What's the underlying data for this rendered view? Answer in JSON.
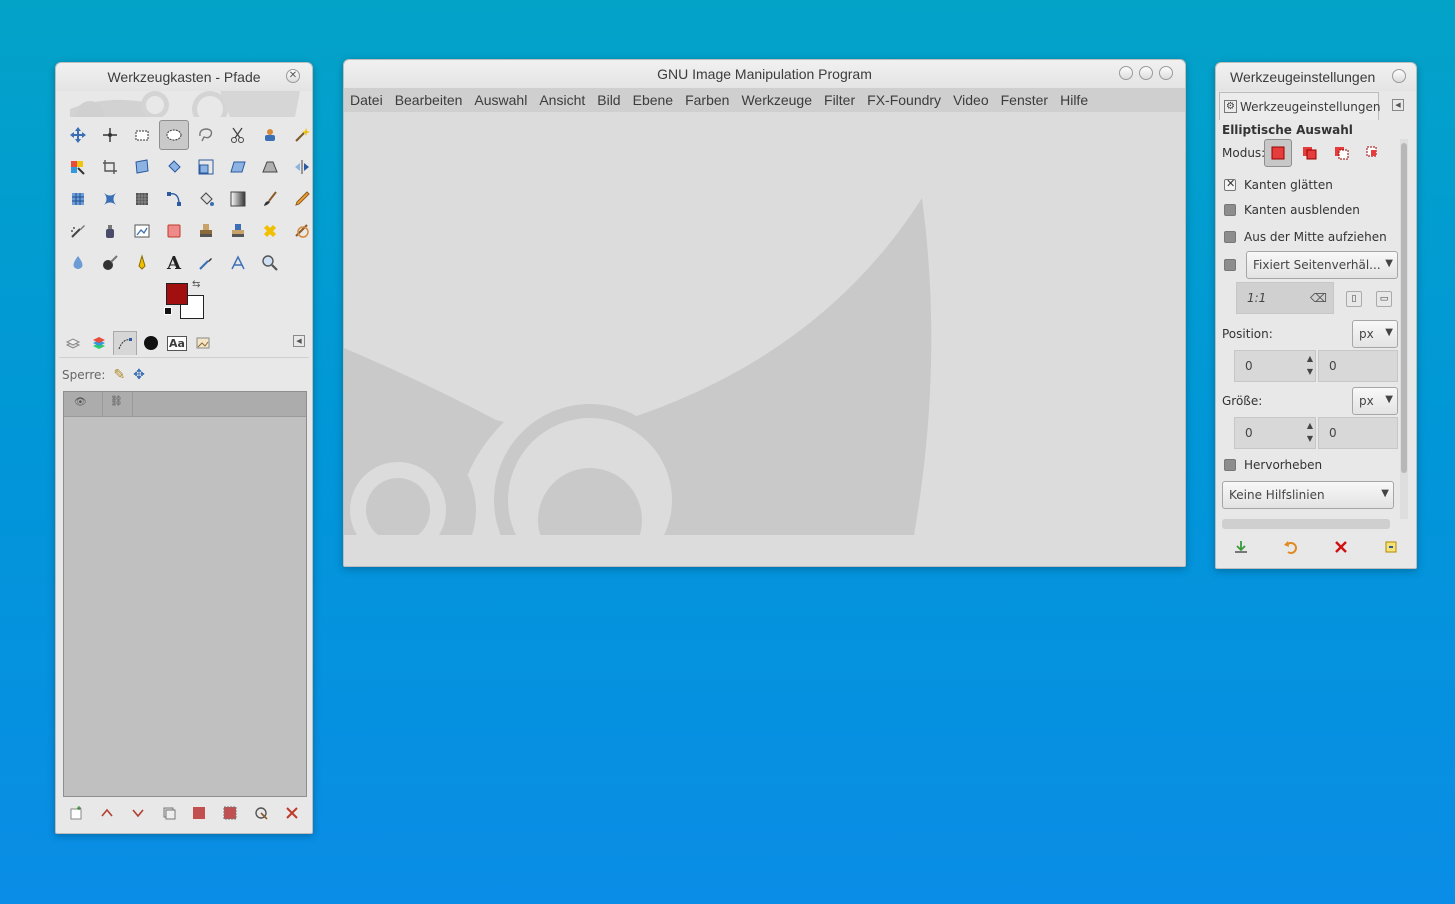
{
  "toolbox": {
    "title": "Werkzeugkasten - Pfade",
    "tools": [
      "move-icon",
      "align-icon",
      "rect-select-icon",
      "ellipse-select-icon",
      "lasso-icon",
      "scissors-select-icon",
      "foreground-select-icon",
      "fuzzy-select-icon",
      "color-select-icon",
      "crop-icon",
      "unified-transform-icon",
      "rotate-icon",
      "scale-icon",
      "shear-icon",
      "perspective-icon",
      "flip-icon",
      "cage-transform-icon",
      "warp-icon",
      "handle-transform-icon",
      "paths-tool-icon",
      "bucket-fill-icon",
      "gradient-icon",
      "paintbrush-icon",
      "pencil-icon",
      "airbrush-icon",
      "ink-icon",
      "mypaint-brush-icon",
      "eraser-icon",
      "clone-icon",
      "heal-icon",
      "smudge-icon",
      "dodge-burn-icon",
      "blur-icon",
      "smudge-alt-icon",
      "dodge-icon",
      "text-icon",
      "color-picker-icon",
      "measure-icon",
      "zoom-icon"
    ],
    "active_tool": "ellipse-select-icon",
    "fg_color": "#a10f0f",
    "bg_color": "#ffffff",
    "text_tool_glyph": "A",
    "dock_tabs": [
      "layers-tab-icon",
      "channels-tab-icon",
      "paths-tab-icon",
      "brushes-tab-icon",
      "fonts-tab-icon",
      "images-tab-icon"
    ],
    "font_tab_label": "Aa",
    "lock_label": "Sperre:",
    "bottom_buttons": [
      "new-path-icon",
      "raise-path-icon",
      "lower-path-icon",
      "duplicate-path-icon",
      "path-to-selection-icon",
      "selection-to-path-icon",
      "paint-along-path-icon",
      "delete-path-icon"
    ]
  },
  "main": {
    "title": "GNU Image Manipulation Program",
    "menu": [
      "Datei",
      "Bearbeiten",
      "Auswahl",
      "Ansicht",
      "Bild",
      "Ebene",
      "Farben",
      "Werkzeuge",
      "Filter",
      "FX-Foundry",
      "Video",
      "Fenster",
      "Hilfe"
    ]
  },
  "options": {
    "title": "Werkzeugeinstellungen",
    "tab_label": "Werkzeugeinstellungen",
    "tool_name": "Elliptische Auswahl",
    "mode_label": "Modus:",
    "antialias_label": "Kanten glätten",
    "antialias_checked": true,
    "feather_label": "Kanten ausblenden",
    "feather_checked": false,
    "expand_center_label": "Aus der Mitte aufziehen",
    "expand_center_checked": false,
    "fixed_checked": false,
    "fixed_combo": "Fixiert Seitenverhäl...",
    "ratio_value": "1:1",
    "position_label": "Position:",
    "position_unit": "px",
    "position_x": "0",
    "position_y": "0",
    "size_label": "Größe:",
    "size_unit": "px",
    "size_w": "0",
    "size_h": "0",
    "highlight_label": "Hervorheben",
    "highlight_checked": false,
    "guides_combo": "Keine Hilfslinien"
  }
}
